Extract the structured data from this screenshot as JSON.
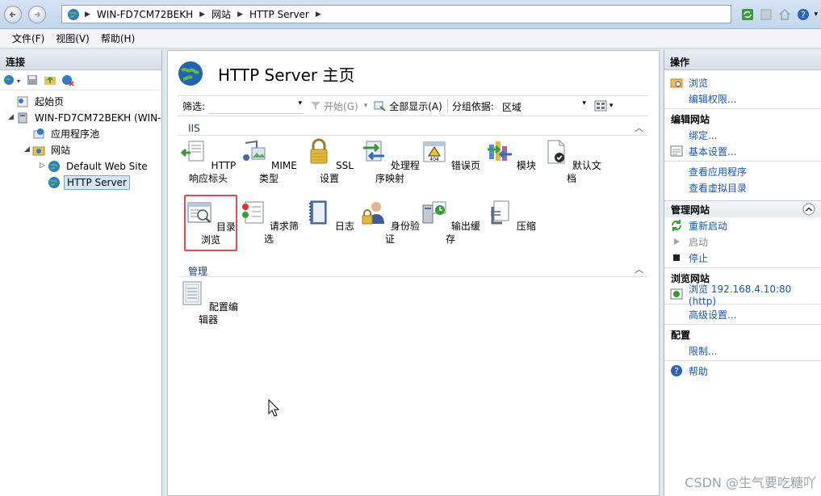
{
  "addressbar": {
    "crumbs": [
      "WIN-FD7CM72BEKH",
      "网站",
      "HTTP Server"
    ]
  },
  "menu": [
    "文件(F)",
    "视图(V)",
    "帮助(H)"
  ],
  "connections": {
    "title": "连接",
    "tree": {
      "start_page": "起始页",
      "server": "WIN-FD7CM72BEKH (WIN-",
      "app_pools": "应用程序池",
      "sites": "网站",
      "default_site": "Default Web Site",
      "http_server": "HTTP Server"
    }
  },
  "main": {
    "title": "HTTP Server 主页",
    "filter": {
      "label": "筛选:",
      "go": "开始(G)",
      "show_all": "全部显示(A)",
      "group_label": "分组依据:",
      "group_value": "区域"
    },
    "sections": [
      {
        "name": "IIS",
        "features": [
          {
            "label": "HTTP 响应标头",
            "icon": "http-response-headers-icon"
          },
          {
            "label": "MIME 类型",
            "icon": "mime-types-icon"
          },
          {
            "label": "SSL 设置",
            "icon": "ssl-lock-icon"
          },
          {
            "label": "处理程序映射",
            "icon": "handler-mappings-icon"
          },
          {
            "label": "错误页",
            "icon": "error-pages-icon"
          },
          {
            "label": "模块",
            "icon": "modules-icon"
          },
          {
            "label": "默认文档",
            "icon": "default-document-icon"
          },
          {
            "label": "目录浏览",
            "icon": "directory-browsing-icon"
          },
          {
            "label": "请求筛选",
            "icon": "request-filtering-icon"
          },
          {
            "label": "日志",
            "icon": "logging-icon"
          },
          {
            "label": "身份验证",
            "icon": "authentication-icon"
          },
          {
            "label": "输出缓存",
            "icon": "output-caching-icon"
          },
          {
            "label": "压缩",
            "icon": "compression-icon"
          }
        ]
      },
      {
        "name": "管理",
        "features": [
          {
            "label": "配置编辑器",
            "icon": "configuration-editor-icon"
          }
        ]
      }
    ]
  },
  "actions": {
    "title": "操作",
    "explore": "浏览",
    "edit_permissions": "编辑权限...",
    "edit_site_title": "编辑网站",
    "bindings": "绑定...",
    "basic_settings": "基本设置...",
    "view_apps": "查看应用程序",
    "view_vdirs": "查看虚拟目录",
    "manage_site_title": "管理网站",
    "restart": "重新启动",
    "start": "启动",
    "stop": "停止",
    "browse_site_title": "浏览网站",
    "browse_url": "浏览 192.168.4.10:80 (http)",
    "advanced_settings": "高级设置...",
    "config_title": "配置",
    "limits": "限制...",
    "help": "帮助"
  },
  "watermark": "CSDN @生气要吃糖吖",
  "colors": {
    "link": "#1a56a8",
    "highlight_border": "#e34b58",
    "selected_bg": "#d5e6f7"
  }
}
